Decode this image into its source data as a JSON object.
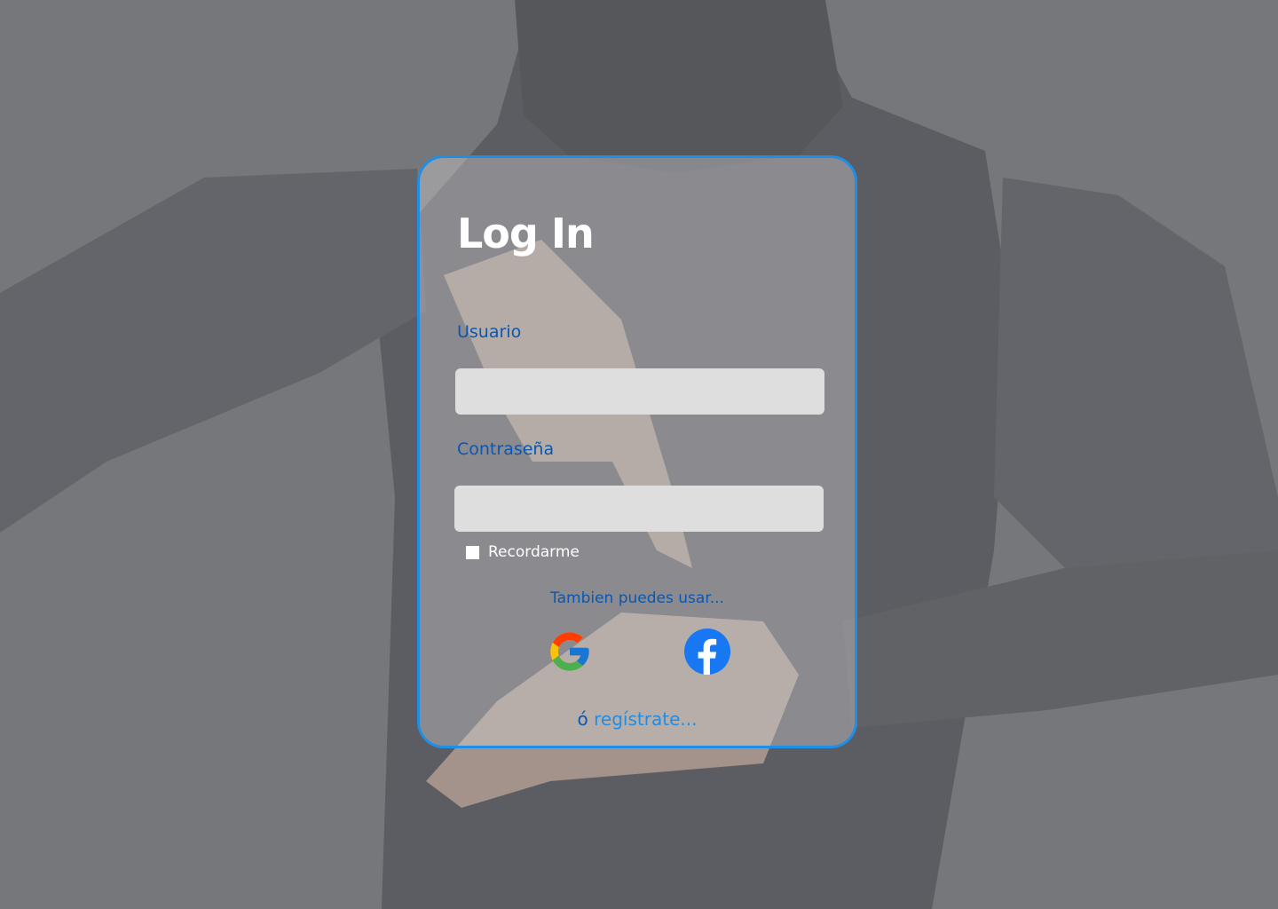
{
  "login": {
    "title": "Log In",
    "username_label": "Usuario",
    "username_value": "",
    "password_label": "Contraseña",
    "password_value": "",
    "remember_label": "Recordarme",
    "alternative_text": "Tambien puedes usar...",
    "or_text": "ó",
    "register_link": "regístrate..."
  },
  "social": [
    {
      "name": "google",
      "icon": "google-icon"
    },
    {
      "name": "facebook",
      "icon": "facebook-icon"
    }
  ],
  "colors": {
    "card_border": "#1e8ee6",
    "label_blue": "#0a56b0",
    "link_blue": "#1e8ee6",
    "input_bg": "#dedede",
    "title": "#ffffff"
  }
}
